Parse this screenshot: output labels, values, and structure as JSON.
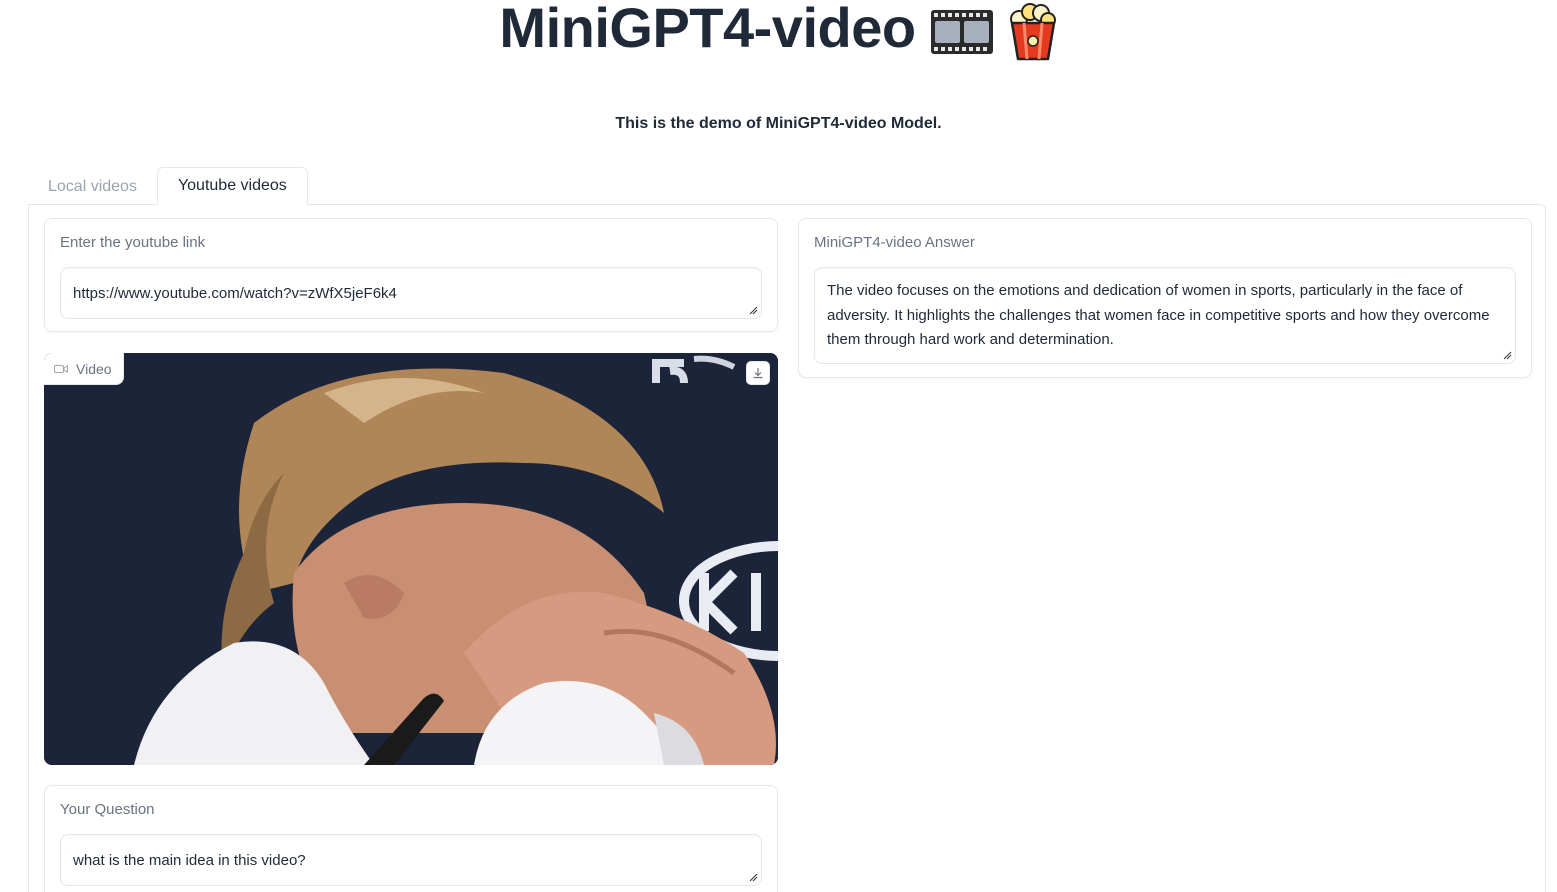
{
  "header": {
    "title": "MiniGPT4-video",
    "title_icons": [
      "film-frames-icon",
      "popcorn-icon"
    ],
    "subtitle": "This is the demo of MiniGPT4-video Model."
  },
  "tabs": [
    {
      "label": "Local videos",
      "active": false
    },
    {
      "label": "Youtube videos",
      "active": true
    }
  ],
  "youtube_link": {
    "label": "Enter the youtube link",
    "value": "https://www.youtube.com/watch?v=zWfX5jeF6k4"
  },
  "video": {
    "label": "Video",
    "icon": "video-camera-icon",
    "download_icon": "download-icon"
  },
  "question": {
    "label": "Your Question",
    "value": "what is the main idea in this video?"
  },
  "answer": {
    "label": "MiniGPT4-video Answer",
    "value": "The video focuses on the emotions and dedication of women in sports, particularly in the face of adversity. It highlights the challenges that women face in competitive sports and how they overcome them through hard work and determination."
  },
  "colors": {
    "text": "#1f2937",
    "muted": "#6b7280",
    "border": "#e5e7eb",
    "video_background": "#1a2236"
  }
}
